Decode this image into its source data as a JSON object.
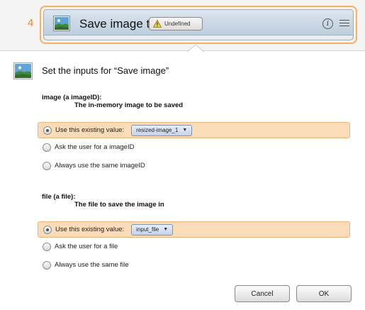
{
  "step": {
    "number": "4",
    "title": "Save image to",
    "parameter_chip": "Undefined",
    "info_icon": "info-icon",
    "menu_icon": "hamburger-menu-icon"
  },
  "dialog": {
    "title": "Set the inputs for “Save image”",
    "sections": [
      {
        "title": "image (a imageID):",
        "description": "The in-memory image to be saved",
        "options": [
          {
            "label": "Use this existing value:",
            "selected": true,
            "value": "resized-image_1"
          },
          {
            "label": "Ask the user for a imageID",
            "selected": false
          },
          {
            "label": "Always use the same imageID",
            "selected": false
          }
        ]
      },
      {
        "title": "file (a file):",
        "description": "The file to save the image in",
        "options": [
          {
            "label": "Use this existing value:",
            "selected": true,
            "value": "input_file"
          },
          {
            "label": "Ask the user for a file",
            "selected": false
          },
          {
            "label": "Always use the same file",
            "selected": false
          }
        ]
      }
    ]
  },
  "buttons": {
    "cancel": "Cancel",
    "ok": "OK"
  },
  "colors": {
    "highlight": "#fbdcb8",
    "highlight_border": "#f0b47a",
    "step_accent": "#e8862a"
  }
}
